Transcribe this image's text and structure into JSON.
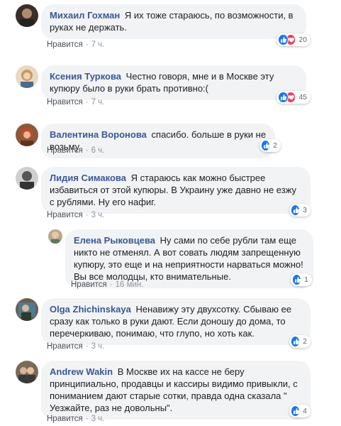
{
  "comments": [
    {
      "author": "Михаил Гохман",
      "text": "Я их тоже стараюсь, по возможности, в руках не держать.",
      "like_label": "Нравится",
      "time": "7 ч.",
      "reaction_count": "20",
      "reactions": [
        "like-icon",
        "love-icon"
      ]
    },
    {
      "author": "Ксения Туркова",
      "text": "Честно говоря, мне и в Москве эту купюру было в руки брать противно:(",
      "like_label": "Нравится",
      "time": "7 ч.",
      "reaction_count": "45",
      "reactions": [
        "like-icon",
        "love-icon"
      ]
    },
    {
      "author": "Валентина Воронова",
      "text": "спасибо. больше в руки не возьму",
      "like_label": "Нравится",
      "time": "6 ч.",
      "reaction_count": "2",
      "reactions": [
        "like-icon"
      ]
    },
    {
      "author": "Лидия Симакова",
      "text": "Я стараюсь как можно быстрее избавиться от этой купюры. В Украину уже давно не езжу с рублями. Ну его нафиг.",
      "like_label": "Нравится",
      "time": "3 ч.",
      "reaction_count": "3",
      "reactions": [
        "like-icon"
      ]
    },
    {
      "author": "Елена Рыковцева",
      "text": "Ну сами по себе рубли там еще никто не отменял. А вот совать людям запрещенную купюру, это еще и на неприятности нарваться можно! Вы все молодцы, кто внимательные.",
      "like_label": "Нравится",
      "time": "16 мин.",
      "reaction_count": "1",
      "reactions": [
        "like-icon"
      ],
      "reply": true
    },
    {
      "author": "Olga Zhichinskaya",
      "text": "Ненавижу эту двухсотку. Сбываю ее сразу как только в руки дают. Если доношу до дома, то перечеркиваю, понимаю, что глупо, но хоть как.",
      "like_label": "Нравится",
      "time": "3 ч.",
      "reaction_count": "2",
      "reactions": [
        "like-icon"
      ]
    },
    {
      "author": "Andrew Wakin",
      "text": "В Москве их на кассе не беру принципиально, продавцы и кассиры видимо привыкли, с пониманием дают старые сотки, правда одна сказала \" Уезжайте, раз не довольны\".",
      "like_label": "Нравится",
      "time": "3 ч.",
      "reaction_count": "4",
      "reactions": [
        "like-icon"
      ]
    }
  ],
  "colors": {
    "author": "#385898",
    "bubble": "#f2f3f5",
    "like": "#1877f2",
    "love": "#f33e58",
    "meta": "#90949c"
  }
}
